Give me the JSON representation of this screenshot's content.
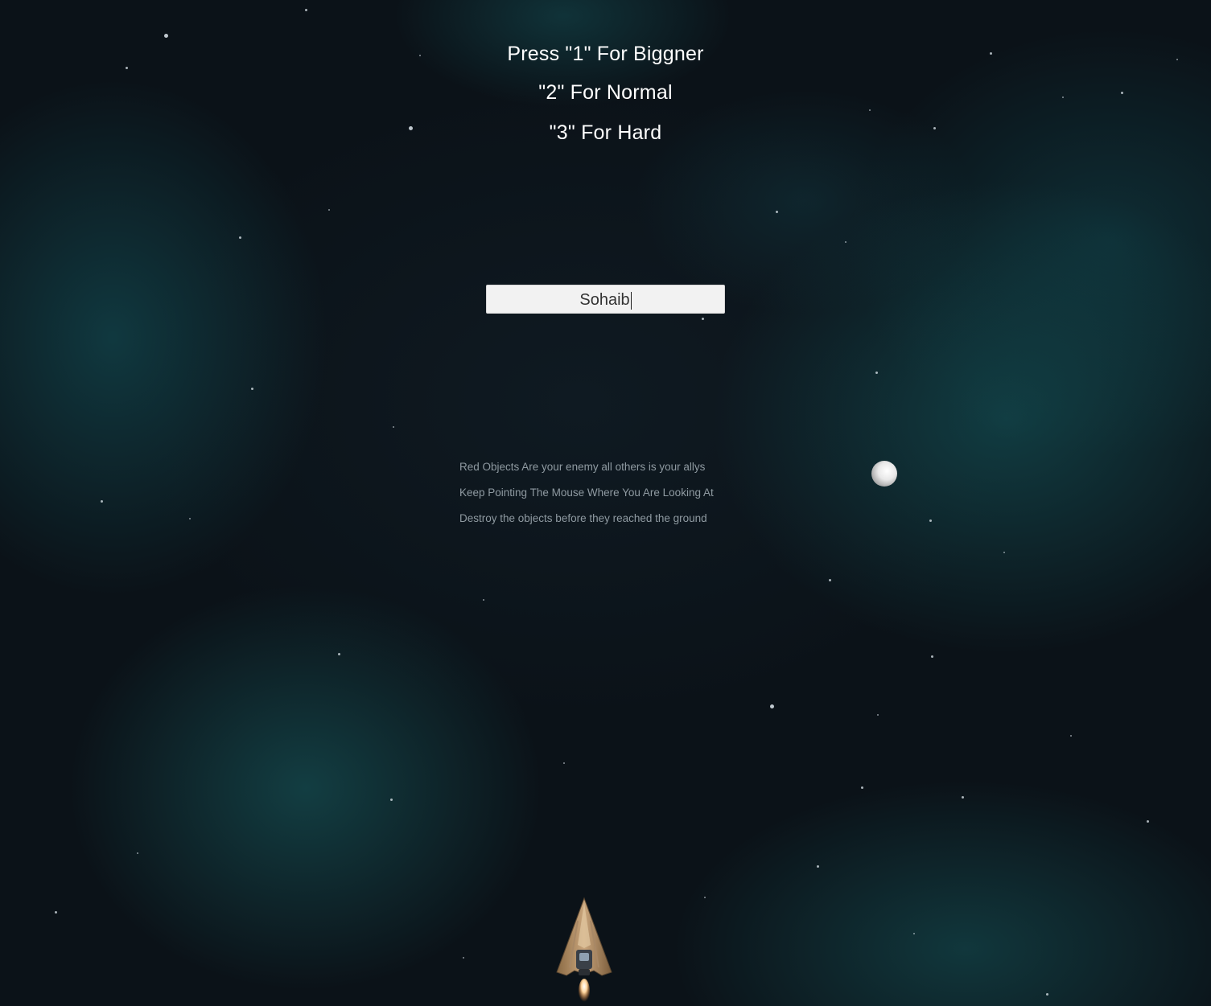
{
  "menu": {
    "line1": "Press \"1\" For Biggner",
    "line2": "\"2\" For Normal",
    "line3": "\"3\" For Hard"
  },
  "player_name_input": {
    "value": "Sohaib"
  },
  "hints": [
    "Red Objects Are your enemy all others is your allys",
    "Keep Pointing The Mouse Where You Are Looking At",
    "Destroy the objects before they reached the ground"
  ],
  "colors": {
    "background": "#0b1218",
    "nebula": "#165f64",
    "menu_text": "#ffffff",
    "hint_text": "#8f9aa1",
    "input_background": "#f2f2f2"
  },
  "sprites": {
    "planet": "white-sphere",
    "player": "spaceship"
  }
}
